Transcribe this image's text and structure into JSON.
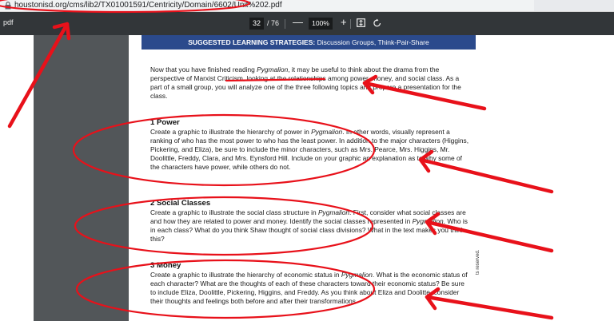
{
  "browser": {
    "url": "houstonisd.org/cms/lib2/TX01001591/Centricity/Domain/6602/Unit%202.pdf"
  },
  "viewer": {
    "title": "pdf",
    "current_page": "32",
    "total_pages": "/ 76",
    "zoom": "100%",
    "minus": "—",
    "plus": "+"
  },
  "document": {
    "banner_bold": "SUGGESTED LEARNING STRATEGIES:",
    "banner_rest": " Discussion Groups, Think-Pair-Share",
    "intro": {
      "a": "Now that you have finished reading ",
      "a_em": "Pygmalion",
      "b": ", it may be useful to think about the drama from the perspective of Marxist Criticism, looking at the relationships among power, money, and social class. As a part of a small group, you will analyze one of the three following topics and prepare a presentation for the class."
    },
    "sections": [
      {
        "heading": "1  Power",
        "a": "Create a graphic to illustrate the hierarchy of power in ",
        "a_em": "Pygmalion",
        "b": ". In other words, visually represent a ranking of who has the most power to who has the least power. In addition to the major characters (Higgins, Pickering, and Eliza), be sure to include the minor characters, such as Mrs. Pearce, Mrs. Higgins, Mr. Doolittle, Freddy, Clara, and Mrs. Eynsford Hill. Include on your graphic an explanation as to why some of the characters have power, while others do not.",
        "b_em": "",
        "c": ""
      },
      {
        "heading": "2  Social Classes",
        "a": "Create a graphic to illustrate the social class structure in ",
        "a_em": "Pygmalion",
        "b": ". First, consider what social classes are and how they are related to power and money. Identify the social classes represented in ",
        "b_em": "Pygmalion",
        "c": ". Who is in each class? What do you think Shaw thought of social class divisions? What in the text makes you think this?"
      },
      {
        "heading": "3  Money",
        "a": "Create a graphic to illustrate the hierarchy of economic status in ",
        "a_em": "Pygmalion",
        "b": ". What is the economic status of each character? What are the thoughts of each of these characters toward their economic status? Be sure to include Eliza, Doolittle, Pickering, Higgins, and Freddy. As you think about Eliza and Doolitte, consider their thoughts and feelings both before and after their transformations.",
        "b_em": "",
        "c": ""
      }
    ],
    "side_note": "ts reserved."
  },
  "icons": [
    "lock-icon",
    "fit-page-icon",
    "rotate-icon"
  ],
  "colors": {
    "annotation_red": "#e8111a",
    "banner_blue": "#2b4a8c",
    "toolbar": "#323639"
  }
}
